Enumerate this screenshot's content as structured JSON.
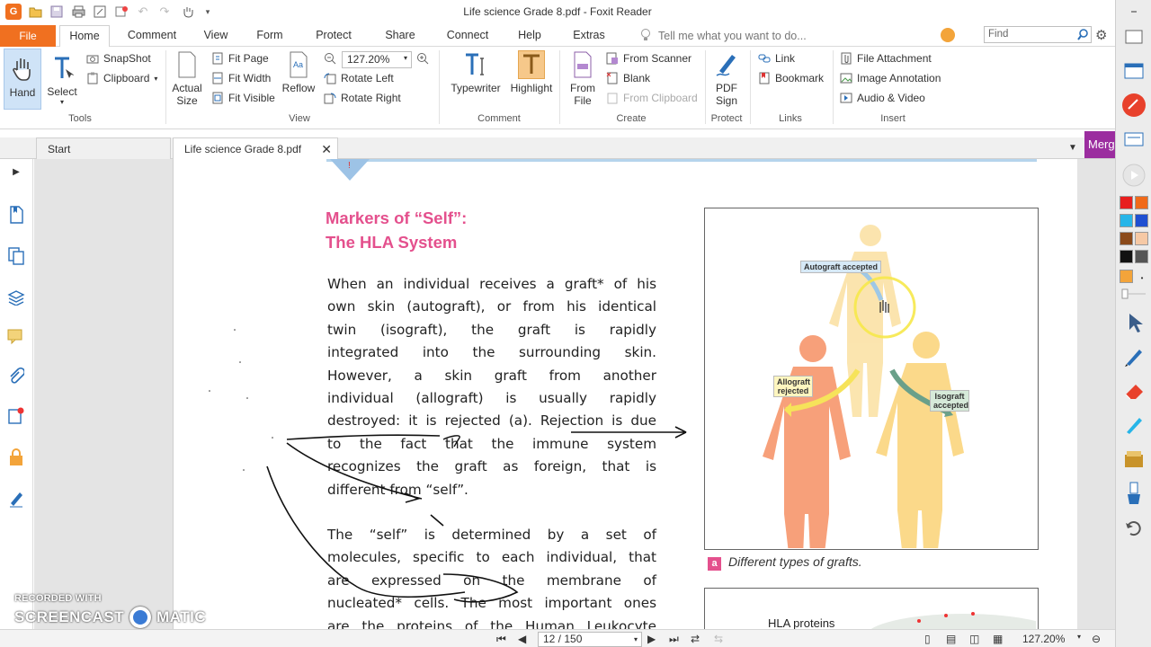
{
  "titlebar": {
    "title": "Life science Grade 8.pdf - Foxit Reader",
    "app_icon_letter": "G"
  },
  "ribbon_tabs": {
    "file": "File",
    "tabs": [
      "Home",
      "Comment",
      "View",
      "Form",
      "Protect",
      "Share",
      "Connect",
      "Help",
      "Extras"
    ],
    "active": "Home",
    "tell_me": "Tell me what you want to do...",
    "find_placeholder": "Find"
  },
  "ribbon": {
    "tools": {
      "hand": "Hand",
      "select": "Select",
      "snapshot": "SnapShot",
      "clipboard": "Clipboard",
      "label": "Tools"
    },
    "view": {
      "actual_size_1": "Actual",
      "actual_size_2": "Size",
      "fit_page": "Fit Page",
      "fit_width": "Fit Width",
      "fit_visible": "Fit Visible",
      "reflow": "Reflow",
      "zoom": "127.20%",
      "rotate_left": "Rotate Left",
      "rotate_right": "Rotate Right",
      "label": "View"
    },
    "comment": {
      "typewriter": "Typewriter",
      "highlight": "Highlight",
      "label": "Comment"
    },
    "create": {
      "from_file_1": "From",
      "from_file_2": "File",
      "from_scanner": "From Scanner",
      "blank": "Blank",
      "from_clipboard": "From Clipboard",
      "label": "Create"
    },
    "protect": {
      "pdf_sign_1": "PDF",
      "pdf_sign_2": "Sign",
      "label": "Protect"
    },
    "links": {
      "link": "Link",
      "bookmark": "Bookmark",
      "label": "Links"
    },
    "insert": {
      "file_attachment": "File Attachment",
      "image_annotation": "Image Annotation",
      "audio_video": "Audio & Video",
      "label": "Insert"
    }
  },
  "doc_tabs": {
    "start": "Start",
    "document": "Life science Grade 8.pdf",
    "merge": "Merg"
  },
  "page": {
    "heading_line1": "Markers of “Self”:",
    "heading_line2": "The HLA System",
    "para1": [
      "When an individual receives a graft* of his",
      "own skin (autograft), or from his identical",
      "twin (isograft), the graft is rapidly",
      "integrated into the surrounding skin.",
      "However, a skin graft from another",
      "individual (allograft) is usually rapidly",
      "destroyed: it is rejected (a). Rejection is due",
      "to the fact that the immune system",
      "recognizes the graft as foreign, that is",
      "different from “self”."
    ],
    "para2": [
      "The “self” is determined by a set of",
      "molecules, specific to each individual, that",
      "are expressed on the membrane of",
      "nucleated* cells. The most important ones",
      "are the proteins of the Human Leukocyte"
    ],
    "figure": {
      "autograft": "Autograft accepted",
      "allograft": "Allograft rejected",
      "isograft": "Isograft accepted",
      "caption_letter": "a",
      "caption": "Different types of grafts.",
      "fig2_label": "HLA proteins"
    }
  },
  "status": {
    "page_indicator": "12 / 150",
    "zoom": "127.20%"
  },
  "watermark": {
    "line1": "RECORDED WITH",
    "line2a": "SCREENCAST",
    "line2b": "MATIC"
  },
  "colors": {
    "accent_orange": "#f07020",
    "heading_pink": "#e4508d",
    "merge_purple": "#9b2d9f",
    "hand_active": "#cfe3f7"
  }
}
